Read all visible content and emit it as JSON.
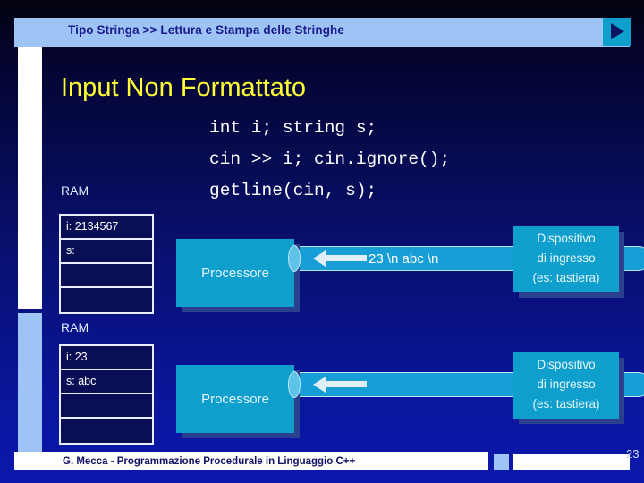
{
  "header": {
    "breadcrumb": "Tipo Stringa >> Lettura e Stampa delle Stringhe",
    "next_icon": "play-triangle-icon",
    "bar_color": "#9ec4f5",
    "text_color": "#1b1b8c"
  },
  "slide": {
    "title": "Input Non Formattato",
    "title_color": "#ffff33",
    "code": "int i; string s;\ncin >> i; cin.ignore();\ngetline(cin, s);"
  },
  "diagram": {
    "rows": [
      {
        "ram_label": "RAM",
        "ram_cells": [
          "i: 2134567",
          "s:",
          "",
          ""
        ],
        "processor_label": "Processore",
        "channel_text": "23 \\n abc \\n",
        "device_lines": [
          "Dispositivo",
          "di ingresso",
          "(es: tastiera)"
        ],
        "arrow_direction": "left"
      },
      {
        "ram_label": "RAM",
        "ram_cells": [
          "i: 23",
          "s: abc",
          "",
          ""
        ],
        "processor_label": "Processore",
        "channel_text": "",
        "device_lines": [
          "Dispositivo",
          "di ingresso",
          "(es: tastiera)"
        ],
        "arrow_direction": "left"
      }
    ],
    "processor_color": "#0f9fcc",
    "pipe_color": "#189ed6",
    "device_color": "#0f9fcc"
  },
  "footer": {
    "credit": "G. Mecca - Programmazione Procedurale in Linguaggio C++",
    "page_number": "23"
  }
}
